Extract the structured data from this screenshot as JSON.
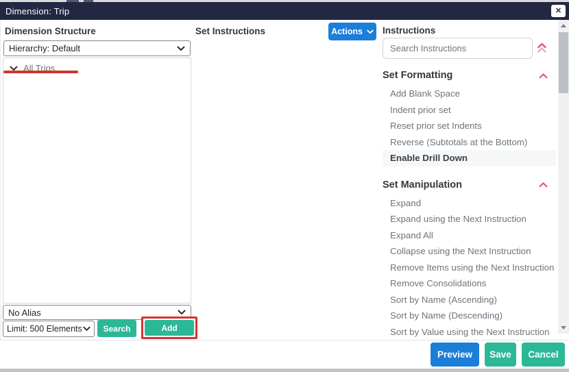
{
  "modal": {
    "title": "Dimension: Trip",
    "close_icon": "✕"
  },
  "dimension_structure": {
    "heading": "Dimension Structure",
    "hierarchy_selected": "Hierarchy: Default",
    "tree_root": "All Trips",
    "alias_selected": "No Alias",
    "limit_selected": "Limit: 500 Elements",
    "search_label": "Search",
    "add_label": "Add"
  },
  "set_instructions": {
    "heading": "Set Instructions",
    "actions_label": "Actions"
  },
  "instructions": {
    "heading": "Instructions",
    "search_placeholder": "Search Instructions",
    "sections": [
      {
        "title": "Set Formatting",
        "items": [
          "Add Blank Space",
          "Indent prior set",
          "Reset prior set Indents",
          "Reverse (Subtotals at the Bottom)",
          "Enable Drill Down"
        ],
        "highlighted_item": "Enable Drill Down"
      },
      {
        "title": "Set Manipulation",
        "items": [
          "Expand",
          "Expand using the Next Instruction",
          "Expand All",
          "Collapse using the Next Instruction",
          "Remove Items using the Next Instruction",
          "Remove Consolidations",
          "Sort by Name (Ascending)",
          "Sort by Name (Descending)",
          "Sort by Value using the Next Instruction"
        ]
      }
    ]
  },
  "footer": {
    "preview_label": "Preview",
    "save_label": "Save",
    "cancel_label": "Cancel"
  },
  "colors": {
    "header_bg": "#222742",
    "primary_blue": "#1b7ed9",
    "teal_green": "#2cb896",
    "annotation_red": "#ce342d",
    "chevron_pink": "#e4566e",
    "chevron_pink_light": "#f2a9b4"
  }
}
